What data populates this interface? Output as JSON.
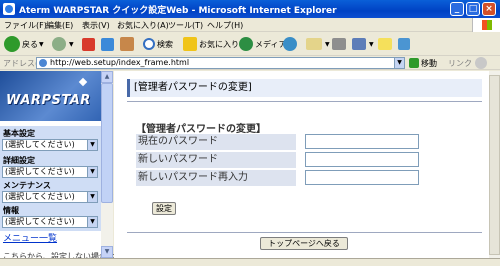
{
  "window": {
    "title": "Aterm WARPSTAR クイック設定Web - Microsoft Internet Explorer",
    "min_label": "_",
    "max_label": "□",
    "close_label": "×"
  },
  "menubar": [
    "ファイル(F)",
    "編集(E)",
    "表示(V)",
    "お気に入り(A)",
    "ツール(T)",
    "ヘルプ(H)"
  ],
  "toolbar": {
    "back_label": "戻る",
    "search_label": "検索",
    "favorites_label": "お気に入り",
    "media_label": "メディア"
  },
  "address": {
    "label": "アドレス(D)",
    "url": "http://web.setup/index_frame.html",
    "go_label": "移動",
    "links_label": "リンク"
  },
  "sidebar": {
    "logo_text": "WARPSTAR",
    "sections": [
      {
        "label": "基本設定",
        "selected": "(選択してください)"
      },
      {
        "label": "詳細設定",
        "selected": "(選択してください)"
      },
      {
        "label": "メンテナンス",
        "selected": "(選択してください)"
      },
      {
        "label": "情報",
        "selected": "(選択してください)"
      }
    ],
    "menu_link": "メニュー一覧",
    "cut_text": "こちらから、設定しない場合は..."
  },
  "main": {
    "heading": "[管理者パスワードの変更]",
    "section_title": "【管理者パスワードの変更】",
    "fields": [
      {
        "label": "現在のパスワード",
        "value": ""
      },
      {
        "label": "新しいパスワード",
        "value": ""
      },
      {
        "label": "新しいパスワード再入力",
        "value": ""
      }
    ],
    "submit_label": "設定",
    "back_top_label": "トップページへ戻る"
  }
}
